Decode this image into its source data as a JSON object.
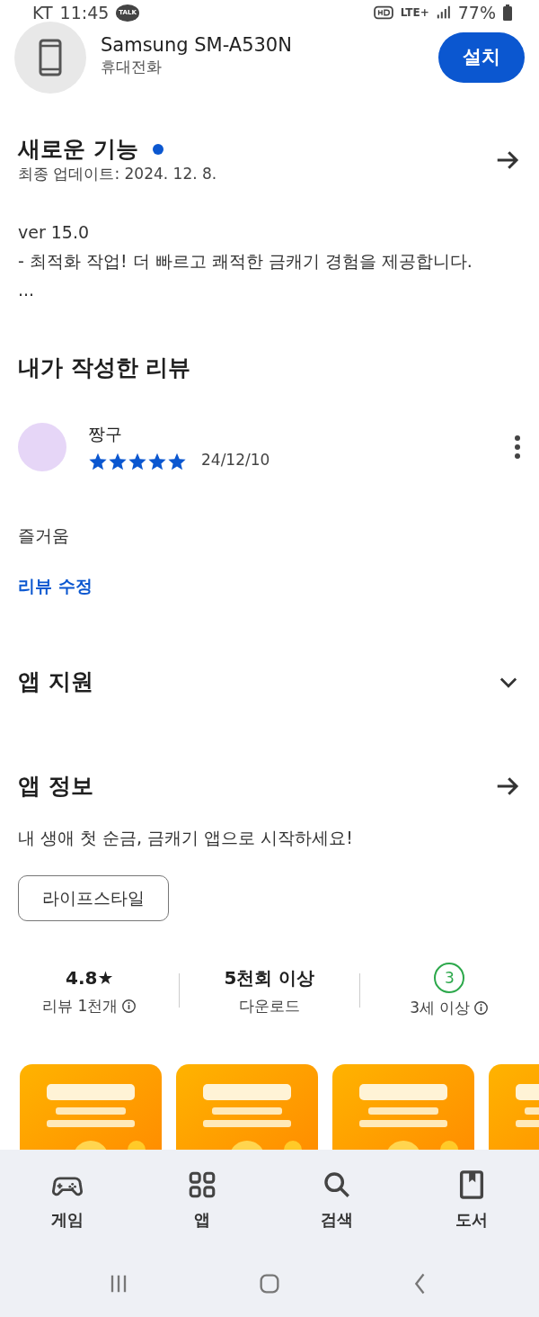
{
  "status_bar": {
    "carrier": "KT",
    "time": "11:45",
    "badge": "TALK",
    "network": "LTE+",
    "battery": "77%"
  },
  "device": {
    "name": "Samsung SM-A530N",
    "type": "휴대전화",
    "button": "설치"
  },
  "whats_new": {
    "title": "새로운 기능",
    "updated": "최종 업데이트: 2024. 12. 8.",
    "lines": [
      "ver 15.0",
      "- 최적화 작업! 더 빠르고 쾌적한 금캐기 경험을 제공합니다.",
      "..."
    ]
  },
  "my_review": {
    "title": "내가 작성한 리뷰",
    "author": "짱구",
    "stars": 5,
    "date": "24/12/10",
    "text": "즐거움",
    "edit_link": "리뷰 수정"
  },
  "app_support": {
    "title": "앱 지원",
    "expanded": false
  },
  "app_info": {
    "title": "앱 정보",
    "description": "내 생애 첫 순금, 금캐기 앱으로 시작하세요!",
    "category": "라이프스타일"
  },
  "stats": [
    {
      "value": "4.8★",
      "label": "리뷰 1천개",
      "info": true
    },
    {
      "value": "5천회 이상",
      "label": "다운로드",
      "info": false
    },
    {
      "value": "3",
      "label": "3세 이상",
      "info": true,
      "kind": "age"
    }
  ],
  "bottom_nav": [
    {
      "label": "게임",
      "kind": "games"
    },
    {
      "label": "앱",
      "kind": "apps"
    },
    {
      "label": "검색",
      "kind": "search"
    },
    {
      "label": "도서",
      "kind": "books"
    }
  ]
}
